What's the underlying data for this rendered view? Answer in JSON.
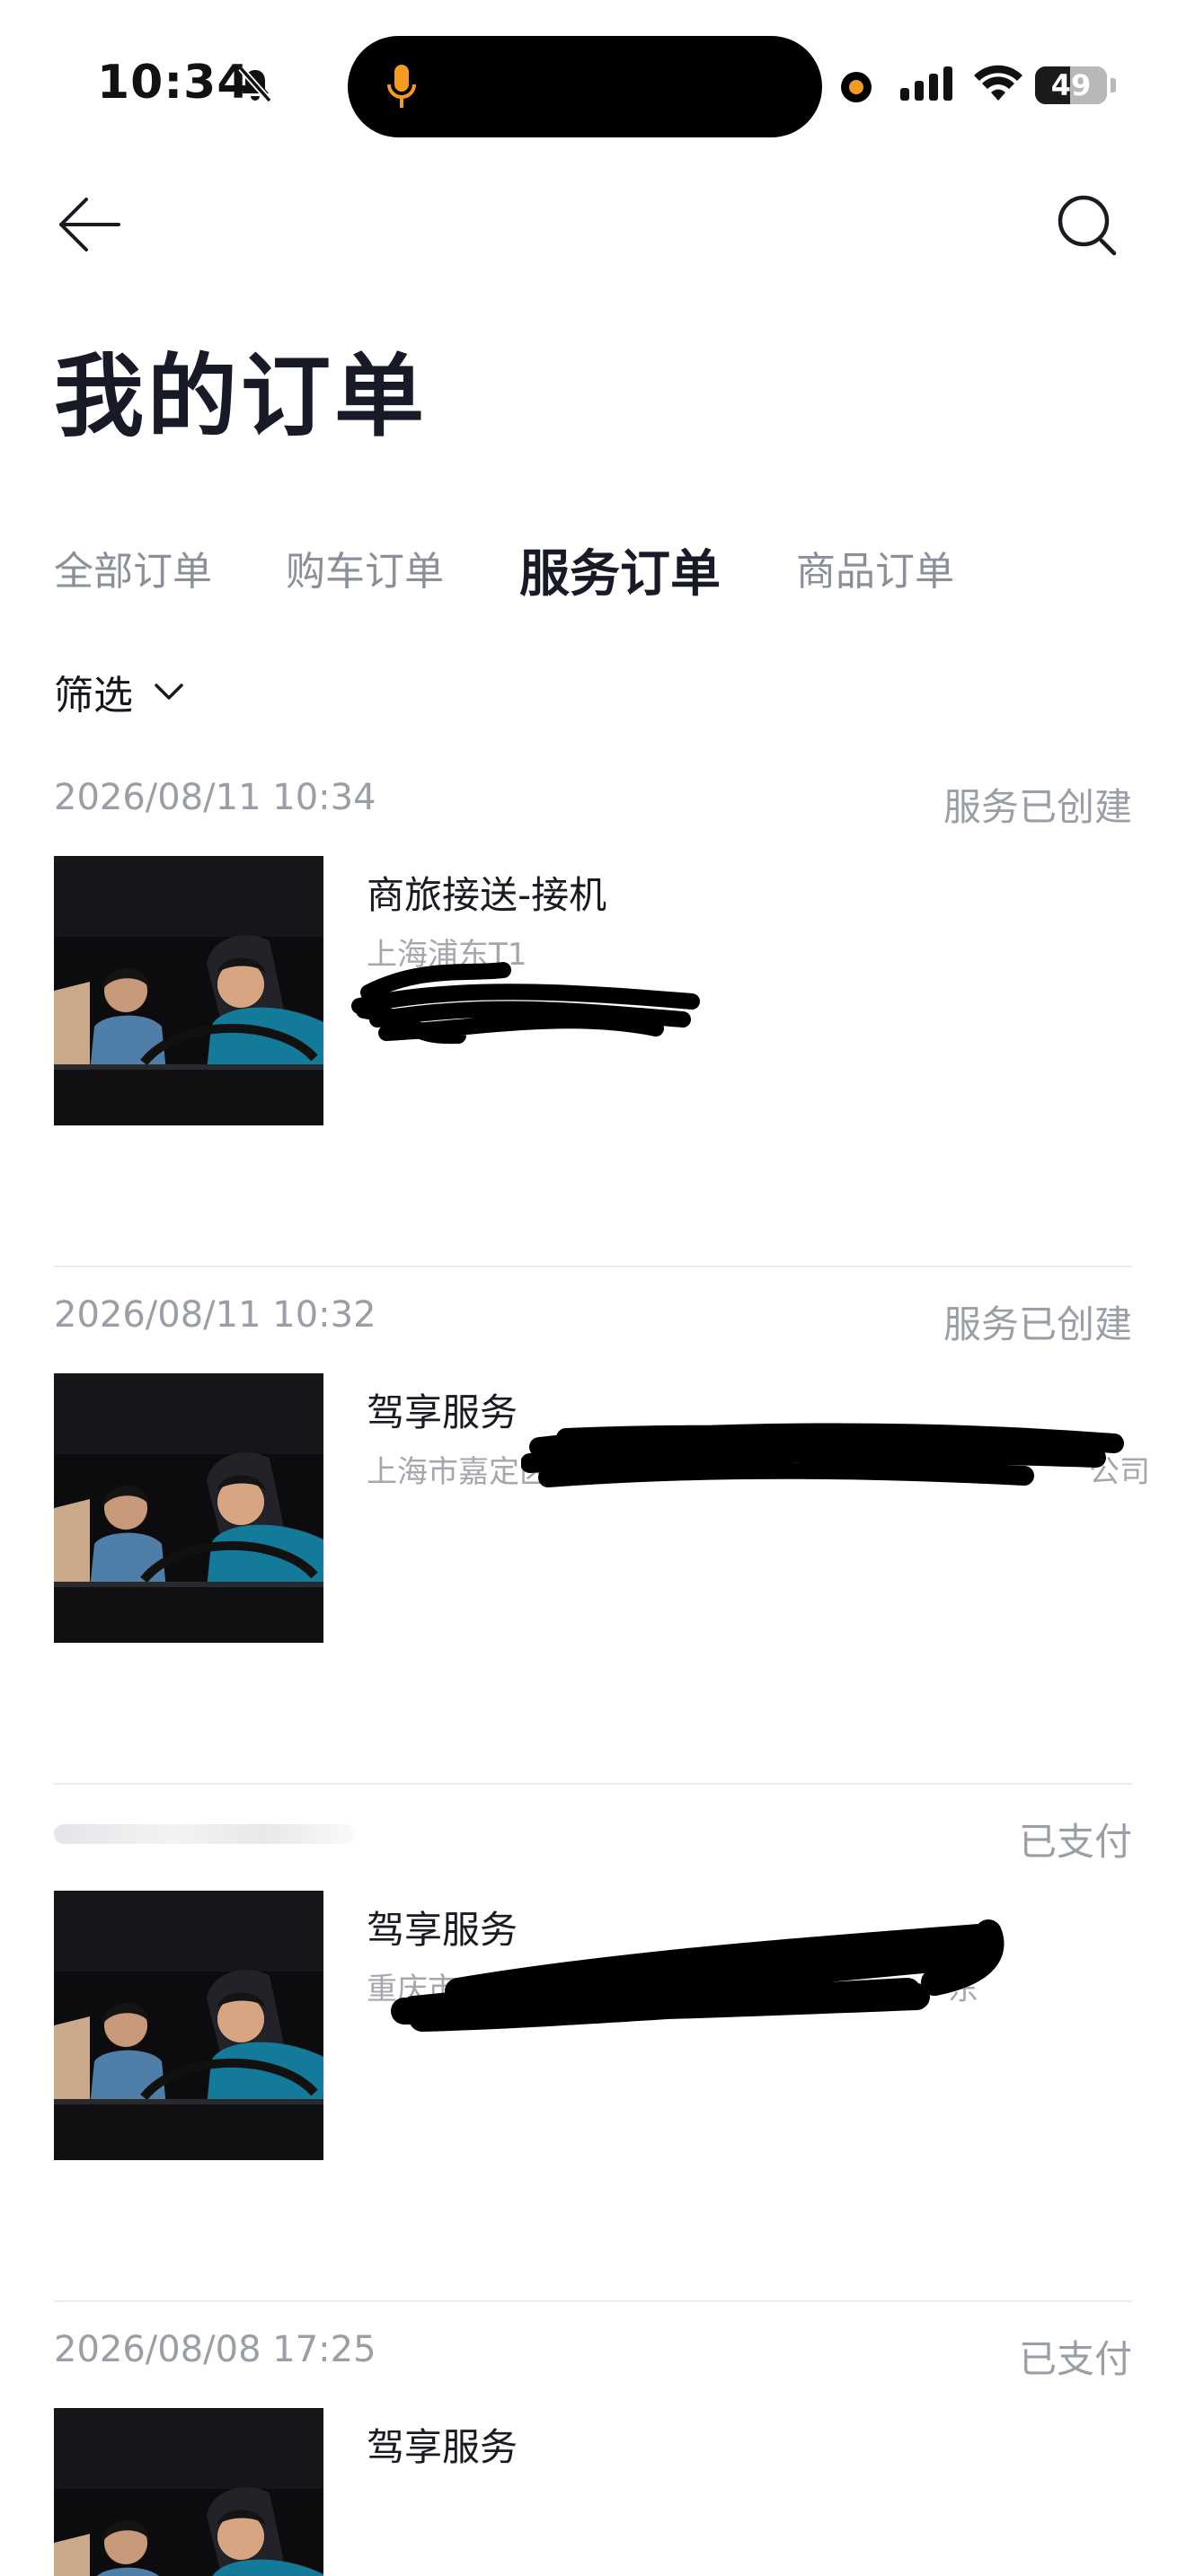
{
  "status_bar": {
    "time": "10:34",
    "battery_label": "49",
    "battery_level": 0.49,
    "recording_color": "#f59a23",
    "icons": [
      "bell-slash-icon",
      "microphone-icon",
      "cellular-signal-icon",
      "wifi-icon",
      "battery-icon"
    ]
  },
  "header": {
    "title": "我的订单",
    "back_icon": "arrow-left-icon",
    "search_icon": "search-icon"
  },
  "tabs": [
    {
      "label": "全部订单",
      "active": false
    },
    {
      "label": "购车订单",
      "active": false
    },
    {
      "label": "服务订单",
      "active": true
    },
    {
      "label": "商品订单",
      "active": false
    }
  ],
  "filter": {
    "label": "筛选",
    "icon": "chevron-down-icon"
  },
  "orders": [
    {
      "date": "2026/08/11 10:34",
      "status": "服务已创建",
      "name": "商旅接送-接机",
      "address": "上海浦东T1"
    },
    {
      "date": "2026/08/11 10:32",
      "status": "服务已创建",
      "name": "驾享服务",
      "address": "上海市嘉定区",
      "address_tail": "公司"
    },
    {
      "date": "",
      "status": "已支付",
      "name": "驾享服务",
      "address": "重庆市",
      "address_tail": "东"
    },
    {
      "date": "2026/08/08 17:25",
      "status": "已支付",
      "name": "驾享服务",
      "address": ""
    }
  ],
  "colors": {
    "title": "#181a28",
    "tab_inactive": "#8a8f99",
    "meta_text": "#9a9ea6",
    "divider": "#ececef"
  }
}
